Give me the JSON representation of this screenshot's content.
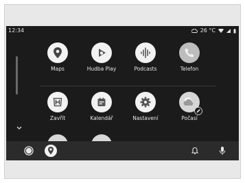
{
  "status": {
    "time": "12:34",
    "temperature": "26 °C"
  },
  "apps": [
    {
      "label": "Maps",
      "icon": "maps-icon"
    },
    {
      "label": "Hudba Play",
      "icon": "play-music-icon"
    },
    {
      "label": "Podcasts",
      "icon": "podcasts-icon"
    },
    {
      "label": "Telefon",
      "icon": "phone-icon"
    },
    {
      "label": "Zavřít",
      "icon": "honda-icon"
    },
    {
      "label": "Kalendář",
      "icon": "calendar-icon"
    },
    {
      "label": "Nastavení",
      "icon": "settings-icon"
    },
    {
      "label": "Počasí",
      "icon": "weather-icon"
    }
  ],
  "nav": {
    "items": [
      "home-circle-icon",
      "maps-icon",
      "bell-icon",
      "microphone-icon"
    ]
  },
  "colors": {
    "screen": "#1b1b1b",
    "nav_bar": "#2b2b2b",
    "icon_bg": "#f2f2f2",
    "text": "#e6e6e6"
  }
}
